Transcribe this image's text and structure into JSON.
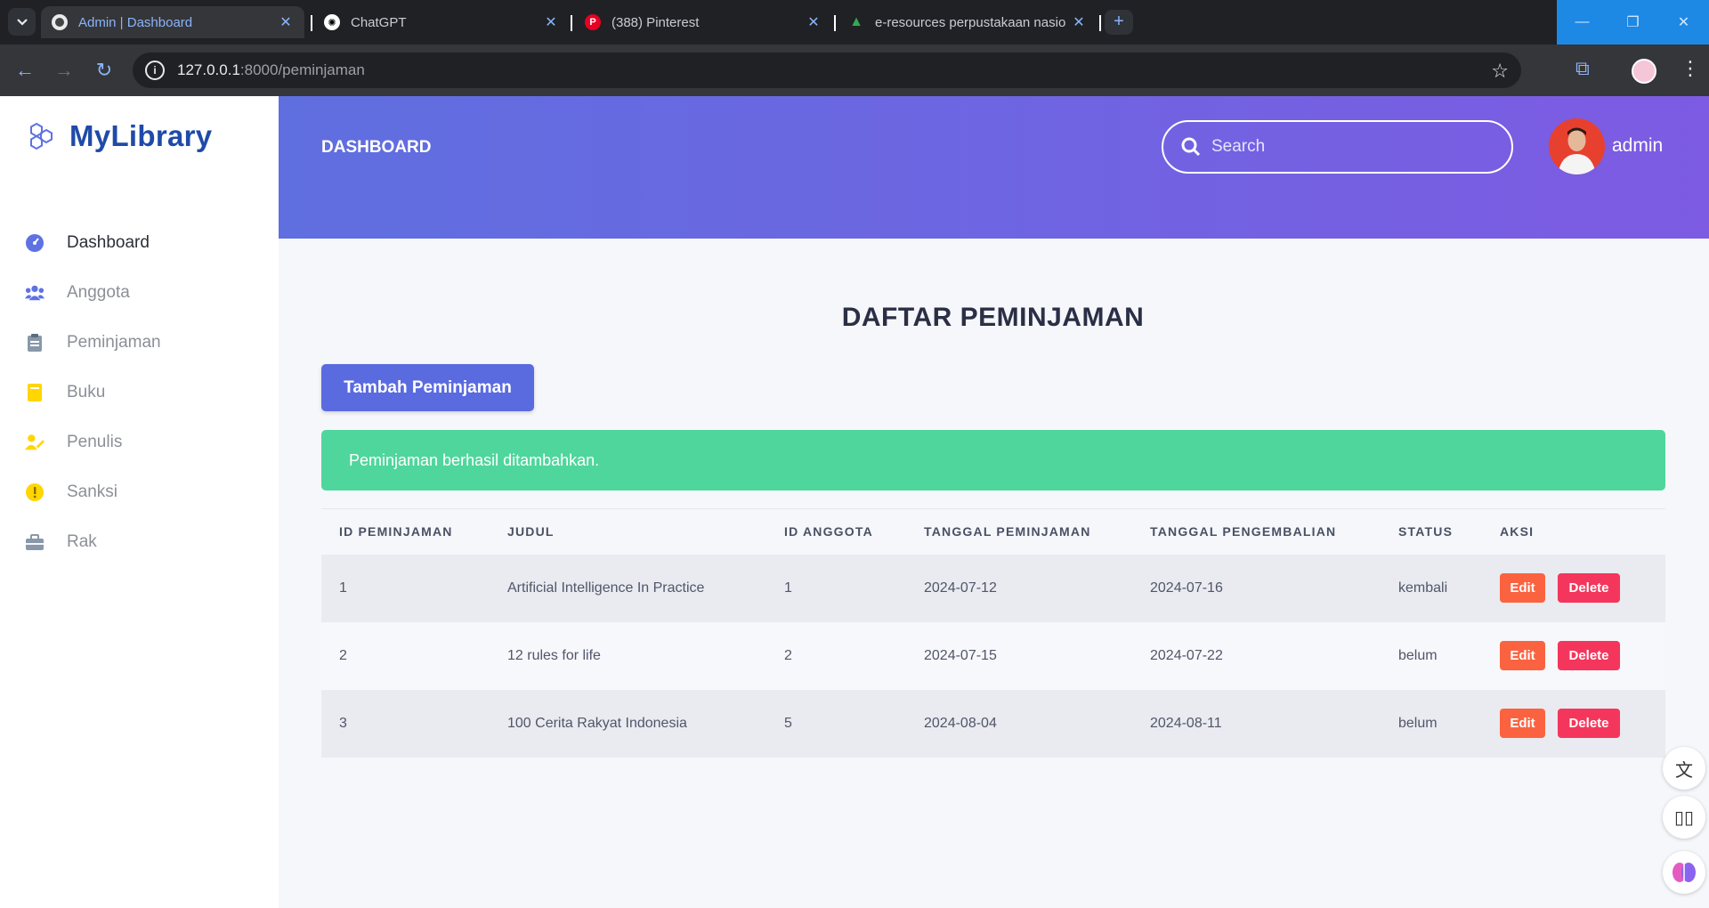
{
  "browser": {
    "tabs": [
      {
        "title": "Admin | Dashboard",
        "active": true
      },
      {
        "title": "ChatGPT",
        "active": false
      },
      {
        "title": "(388) Pinterest",
        "active": false
      },
      {
        "title": "e-resources perpustakaan nasio",
        "active": false
      }
    ],
    "url_host": "127.0.0.1",
    "url_rest": ":8000/peminjaman"
  },
  "sidebar": {
    "brand": "MyLibrary",
    "items": [
      {
        "label": "Dashboard",
        "icon": "dashboard-icon",
        "color": "#5e72e4"
      },
      {
        "label": "Anggota",
        "icon": "users-icon",
        "color": "#5e72e4"
      },
      {
        "label": "Peminjaman",
        "icon": "clipboard-icon",
        "color": "#8898aa"
      },
      {
        "label": "Buku",
        "icon": "book-icon",
        "color": "#ffd600"
      },
      {
        "label": "Penulis",
        "icon": "user-pen-icon",
        "color": "#ffd600"
      },
      {
        "label": "Sanksi",
        "icon": "warning-icon",
        "color": "#ffd600"
      },
      {
        "label": "Rak",
        "icon": "shelf-icon",
        "color": "#8898aa"
      }
    ]
  },
  "header": {
    "title": "DASHBOARD",
    "search_placeholder": "Search",
    "user": "admin"
  },
  "main": {
    "title": "DAFTAR PEMINJAMAN",
    "add_button": "Tambah Peminjaman",
    "alert": "Peminjaman berhasil ditambahkan.",
    "columns": [
      "ID PEMINJAMAN",
      "JUDUL",
      "ID ANGGOTA",
      "TANGGAL PEMINJAMAN",
      "TANGGAL PENGEMBALIAN",
      "STATUS",
      "AKSI"
    ],
    "rows": [
      [
        "1",
        "Artificial Intelligence In Practice",
        "1",
        "2024-07-12",
        "2024-07-16",
        "kembali"
      ],
      [
        "2",
        "12 rules for life",
        "2",
        "2024-07-15",
        "2024-07-22",
        "belum"
      ],
      [
        "3",
        "100 Cerita Rakyat Indonesia",
        "5",
        "2024-08-04",
        "2024-08-11",
        "belum"
      ]
    ],
    "edit_label": "Edit",
    "delete_label": "Delete"
  },
  "colors": {
    "header_gradient_start": "#5f6fe0",
    "header_gradient_end": "#7d5be3",
    "primary": "#5a6be0",
    "success": "#4fd69c",
    "edit": "#fb6340",
    "delete": "#f5365c"
  }
}
